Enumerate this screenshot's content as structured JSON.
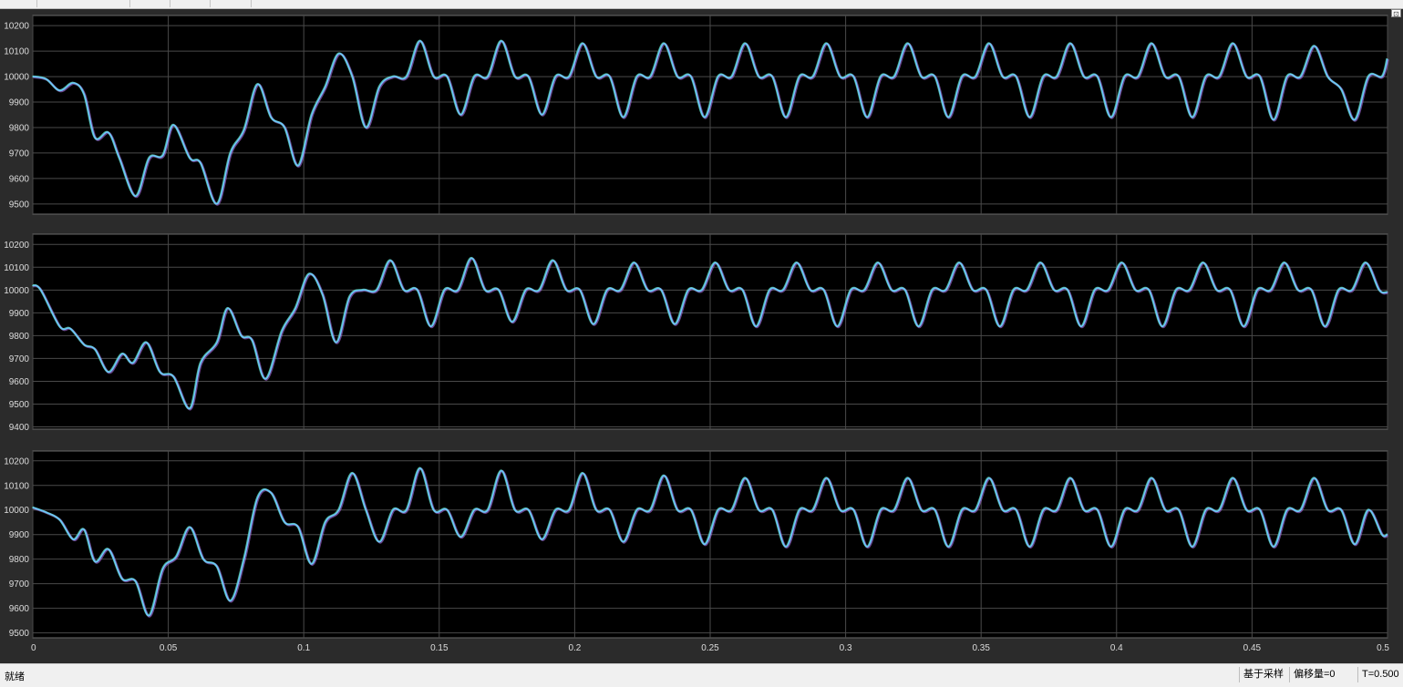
{
  "status": {
    "text": "就绪",
    "sampling": "基于采样",
    "offset": "偏移量=0",
    "time": "T=0.500"
  },
  "colors": {
    "background": "#000000",
    "frame": "#2b2b2b",
    "grid": "#4a4a4a",
    "axis_text": "#dcdcdc",
    "traces": [
      "#6fc3ff",
      "#5fe0c0",
      "#c07cff",
      "#e0e060",
      "#ff6b6b",
      "#7ee37e"
    ]
  },
  "icons": {
    "restore": "restore-window-icon"
  },
  "chart_data": [
    {
      "type": "line",
      "xlim": [
        0,
        0.5
      ],
      "ylim": [
        9460,
        10240
      ],
      "xticks": [
        "0",
        "0.05",
        "0.1",
        "0.15",
        "0.2",
        "0.25",
        "0.3",
        "0.35",
        "0.4",
        "0.45",
        "0.5"
      ],
      "yticks": [
        "9500",
        "9600",
        "9700",
        "9800",
        "9900",
        "10000",
        "10100",
        "10200"
      ],
      "grid": true,
      "series": [
        {
          "x": [
            0,
            0.005,
            0.01,
            0.015,
            0.019,
            0.023,
            0.028,
            0.032,
            0.038,
            0.043,
            0.048,
            0.052,
            0.058,
            0.062,
            0.068,
            0.073,
            0.078,
            0.083,
            0.088,
            0.093,
            0.098,
            0.103,
            0.108,
            0.113,
            0.118,
            0.123,
            0.128,
            0.133,
            0.138,
            0.143,
            0.148,
            0.153,
            0.158,
            0.163,
            0.168,
            0.173,
            0.178,
            0.183,
            0.188,
            0.193,
            0.198,
            0.203,
            0.208,
            0.213,
            0.218,
            0.223,
            0.228,
            0.233,
            0.238,
            0.243,
            0.248,
            0.253,
            0.258,
            0.263,
            0.268,
            0.273,
            0.278,
            0.283,
            0.288,
            0.293,
            0.298,
            0.303,
            0.308,
            0.313,
            0.318,
            0.323,
            0.328,
            0.333,
            0.338,
            0.343,
            0.348,
            0.353,
            0.358,
            0.363,
            0.368,
            0.373,
            0.378,
            0.383,
            0.388,
            0.393,
            0.398,
            0.403,
            0.408,
            0.413,
            0.418,
            0.423,
            0.428,
            0.433,
            0.438,
            0.443,
            0.448,
            0.453,
            0.458,
            0.463,
            0.468,
            0.473,
            0.478,
            0.483,
            0.488,
            0.493,
            0.498,
            0.5
          ],
          "y": [
            10000,
            9990,
            9945,
            9975,
            9930,
            9760,
            9780,
            9680,
            9530,
            9680,
            9690,
            9810,
            9680,
            9660,
            9500,
            9700,
            9790,
            9970,
            9840,
            9800,
            9650,
            9850,
            9960,
            10090,
            10000,
            9800,
            9960,
            10000,
            10000,
            10140,
            10000,
            10000,
            9850,
            10000,
            10000,
            10140,
            10000,
            10000,
            9850,
            10000,
            10000,
            10130,
            10000,
            10000,
            9840,
            10000,
            10000,
            10130,
            10000,
            10000,
            9840,
            10000,
            10000,
            10130,
            10000,
            10000,
            9840,
            10000,
            10000,
            10130,
            10000,
            10000,
            9840,
            10000,
            10000,
            10130,
            10000,
            10000,
            9840,
            10000,
            10000,
            10130,
            10000,
            10000,
            9840,
            10000,
            10000,
            10130,
            10000,
            10000,
            9840,
            10000,
            10000,
            10130,
            10000,
            10000,
            9840,
            10000,
            10000,
            10130,
            10000,
            10000,
            9830,
            10000,
            10000,
            10120,
            10000,
            9950,
            9830,
            10000,
            10000,
            10070
          ]
        }
      ]
    },
    {
      "type": "line",
      "xlim": [
        0,
        0.5
      ],
      "ylim": [
        9390,
        10245
      ],
      "xticks": [
        "0",
        "0.05",
        "0.1",
        "0.15",
        "0.2",
        "0.25",
        "0.3",
        "0.35",
        "0.4",
        "0.45",
        "0.5"
      ],
      "yticks": [
        "9400",
        "9500",
        "9600",
        "9700",
        "9800",
        "9900",
        "10000",
        "10100",
        "10200"
      ],
      "grid": true,
      "series": [
        {
          "x": [
            0,
            0.003,
            0.01,
            0.014,
            0.019,
            0.023,
            0.028,
            0.033,
            0.037,
            0.042,
            0.047,
            0.052,
            0.058,
            0.062,
            0.068,
            0.072,
            0.077,
            0.081,
            0.086,
            0.092,
            0.097,
            0.102,
            0.107,
            0.112,
            0.117,
            0.122,
            0.127,
            0.132,
            0.137,
            0.142,
            0.147,
            0.152,
            0.157,
            0.162,
            0.167,
            0.172,
            0.177,
            0.182,
            0.187,
            0.192,
            0.197,
            0.202,
            0.207,
            0.212,
            0.217,
            0.222,
            0.227,
            0.232,
            0.237,
            0.242,
            0.247,
            0.252,
            0.257,
            0.262,
            0.267,
            0.272,
            0.277,
            0.282,
            0.287,
            0.292,
            0.297,
            0.302,
            0.307,
            0.312,
            0.317,
            0.322,
            0.327,
            0.332,
            0.337,
            0.342,
            0.347,
            0.352,
            0.357,
            0.362,
            0.367,
            0.372,
            0.377,
            0.382,
            0.387,
            0.392,
            0.397,
            0.402,
            0.407,
            0.412,
            0.417,
            0.422,
            0.427,
            0.432,
            0.437,
            0.442,
            0.447,
            0.452,
            0.457,
            0.462,
            0.467,
            0.472,
            0.477,
            0.482,
            0.487,
            0.492,
            0.497,
            0.5
          ],
          "y": [
            10020,
            10000,
            9840,
            9830,
            9760,
            9740,
            9640,
            9720,
            9680,
            9770,
            9640,
            9620,
            9480,
            9680,
            9770,
            9920,
            9800,
            9780,
            9610,
            9820,
            9920,
            10070,
            9980,
            9770,
            9970,
            10000,
            10000,
            10130,
            10000,
            10000,
            9840,
            10000,
            10000,
            10140,
            10000,
            10000,
            9860,
            10000,
            10000,
            10130,
            10000,
            10000,
            9850,
            10000,
            10000,
            10120,
            10000,
            10000,
            9850,
            10000,
            10000,
            10120,
            10000,
            10000,
            9840,
            10000,
            10000,
            10120,
            10000,
            10000,
            9840,
            10000,
            10000,
            10120,
            10000,
            10000,
            9840,
            10000,
            10000,
            10120,
            10000,
            10000,
            9840,
            10000,
            10000,
            10120,
            10000,
            10000,
            9840,
            10000,
            10000,
            10120,
            10000,
            10000,
            9840,
            10000,
            10000,
            10120,
            10000,
            10000,
            9840,
            10000,
            10000,
            10120,
            10000,
            10000,
            9840,
            10000,
            10000,
            10120,
            10000,
            9990
          ]
        }
      ]
    },
    {
      "type": "line",
      "xlim": [
        0,
        0.5
      ],
      "ylim": [
        9480,
        10240
      ],
      "xticks": [
        "0",
        "0.05",
        "0.1",
        "0.15",
        "0.2",
        "0.25",
        "0.3",
        "0.35",
        "0.4",
        "0.45",
        "0.5"
      ],
      "yticks": [
        "9500",
        "9600",
        "9700",
        "9800",
        "9900",
        "10000",
        "10100",
        "10200"
      ],
      "grid": true,
      "series": [
        {
          "x": [
            0,
            0.005,
            0.01,
            0.015,
            0.019,
            0.023,
            0.028,
            0.033,
            0.038,
            0.043,
            0.048,
            0.053,
            0.058,
            0.063,
            0.068,
            0.073,
            0.078,
            0.083,
            0.088,
            0.093,
            0.098,
            0.103,
            0.108,
            0.113,
            0.118,
            0.123,
            0.128,
            0.133,
            0.138,
            0.143,
            0.148,
            0.153,
            0.158,
            0.163,
            0.168,
            0.173,
            0.178,
            0.183,
            0.188,
            0.193,
            0.198,
            0.203,
            0.208,
            0.213,
            0.218,
            0.223,
            0.228,
            0.233,
            0.238,
            0.243,
            0.248,
            0.253,
            0.258,
            0.263,
            0.268,
            0.273,
            0.278,
            0.283,
            0.288,
            0.293,
            0.298,
            0.303,
            0.308,
            0.313,
            0.318,
            0.323,
            0.328,
            0.333,
            0.338,
            0.343,
            0.348,
            0.353,
            0.358,
            0.363,
            0.368,
            0.373,
            0.378,
            0.383,
            0.388,
            0.393,
            0.398,
            0.403,
            0.408,
            0.413,
            0.418,
            0.423,
            0.428,
            0.433,
            0.438,
            0.443,
            0.448,
            0.453,
            0.458,
            0.463,
            0.468,
            0.473,
            0.478,
            0.483,
            0.488,
            0.493,
            0.498,
            0.5
          ],
          "y": [
            10010,
            9990,
            9960,
            9880,
            9920,
            9790,
            9840,
            9720,
            9710,
            9570,
            9760,
            9810,
            9930,
            9800,
            9770,
            9630,
            9800,
            10050,
            10070,
            9950,
            9930,
            9780,
            9950,
            10000,
            10150,
            10000,
            9870,
            10000,
            10000,
            10170,
            10000,
            10000,
            9890,
            10000,
            10000,
            10160,
            10000,
            10000,
            9880,
            10000,
            10000,
            10150,
            10000,
            10000,
            9870,
            10000,
            10000,
            10140,
            10000,
            10000,
            9860,
            10000,
            10000,
            10130,
            10000,
            10000,
            9850,
            10000,
            10000,
            10130,
            10000,
            10000,
            9850,
            10000,
            10000,
            10130,
            10000,
            10000,
            9850,
            10000,
            10000,
            10130,
            10000,
            10000,
            9850,
            10000,
            10000,
            10130,
            10000,
            10000,
            9850,
            10000,
            10000,
            10130,
            10000,
            10000,
            9850,
            10000,
            10000,
            10130,
            10000,
            10000,
            9850,
            10000,
            10000,
            10130,
            10000,
            10000,
            9860,
            10000,
            9900,
            9900
          ]
        }
      ]
    }
  ]
}
